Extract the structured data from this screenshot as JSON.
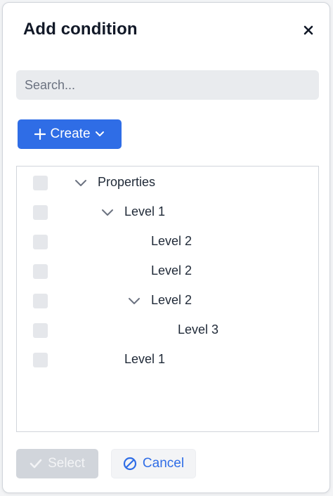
{
  "dialog": {
    "title": "Add condition",
    "close_icon": "close-icon"
  },
  "search": {
    "placeholder": "Search...",
    "value": ""
  },
  "toolbar": {
    "create_label": "Create",
    "create_icon": "plus-icon",
    "create_dropdown_icon": "chevron-down-icon"
  },
  "tree": {
    "nodes": [
      {
        "label": "Properties",
        "depth": 0,
        "expanded": true,
        "has_children": true,
        "checked": false
      },
      {
        "label": "Level 1",
        "depth": 1,
        "expanded": true,
        "has_children": true,
        "checked": false
      },
      {
        "label": "Level 2",
        "depth": 2,
        "has_children": false,
        "checked": false
      },
      {
        "label": "Level 2",
        "depth": 2,
        "has_children": false,
        "checked": false
      },
      {
        "label": "Level 2",
        "depth": 2,
        "expanded": true,
        "has_children": true,
        "checked": false
      },
      {
        "label": "Level 3",
        "depth": 3,
        "has_children": false,
        "checked": false
      },
      {
        "label": "Level 1",
        "depth": 1,
        "has_children": false,
        "checked": false
      }
    ]
  },
  "footer": {
    "select_label": "Select",
    "select_enabled": false,
    "cancel_label": "Cancel"
  },
  "colors": {
    "accent": "#2f6de6",
    "disabled": "#d1d5db",
    "checkbox": "#e5e7eb"
  }
}
